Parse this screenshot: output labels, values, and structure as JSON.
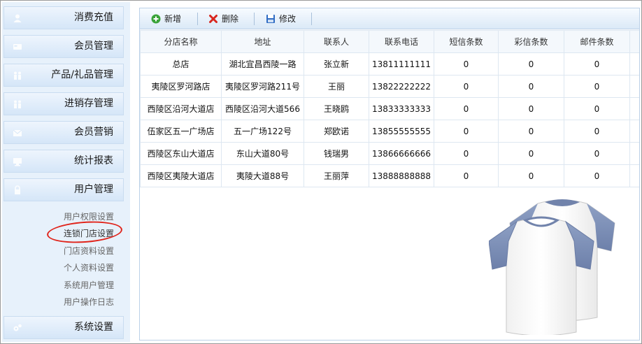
{
  "sidebar": {
    "menu": [
      {
        "label": "消费充值",
        "icon": "user-icon"
      },
      {
        "label": "会员管理",
        "icon": "card-icon"
      },
      {
        "label": "产品/礼品管理",
        "icon": "gift-icon"
      },
      {
        "label": "进销存管理",
        "icon": "box-icon"
      },
      {
        "label": "会员营销",
        "icon": "mail-icon"
      },
      {
        "label": "统计报表",
        "icon": "monitor-icon"
      },
      {
        "label": "用户管理",
        "icon": "lock-icon"
      },
      {
        "label": "系统设置",
        "icon": "gears-icon"
      }
    ],
    "submenu": [
      {
        "label": "用户权限设置"
      },
      {
        "label": "连锁门店设置"
      },
      {
        "label": "门店资料设置"
      },
      {
        "label": "个人资料设置"
      },
      {
        "label": "系统用户管理"
      },
      {
        "label": "用户操作日志"
      }
    ]
  },
  "toolbar": {
    "add_label": "新增",
    "delete_label": "删除",
    "edit_label": "修改"
  },
  "table": {
    "headers": [
      "分店名称",
      "地址",
      "联系人",
      "联系电话",
      "短信条数",
      "彩信条数",
      "邮件条数"
    ],
    "rows": [
      [
        "总店",
        "湖北宜昌西陵一路",
        "张立新",
        "13811111111",
        "0",
        "0",
        "0"
      ],
      [
        "夷陵区罗河路店",
        "夷陵区罗河路211号",
        "王丽",
        "13822222222",
        "0",
        "0",
        "0"
      ],
      [
        "西陵区沿河大道店",
        "西陵区沿河大道566",
        "王晓鸥",
        "13833333333",
        "0",
        "0",
        "0"
      ],
      [
        "伍家区五一广场店",
        "五一广场122号",
        "郑欧诺",
        "13855555555",
        "0",
        "0",
        "0"
      ],
      [
        "西陵区东山大道店",
        "东山大道80号",
        "钱瑞男",
        "13866666666",
        "0",
        "0",
        "0"
      ],
      [
        "西陵区夷陵大道店",
        "夷陵大道88号",
        "王丽萍",
        "13888888888",
        "0",
        "0",
        "0"
      ]
    ]
  },
  "colors": {
    "sidebar_bg": "#e7f1fb",
    "highlight_circle": "#e0241b",
    "add_icon": "#3aa33a",
    "delete_icon": "#d8261e",
    "edit_icon": "#2f6cc4"
  }
}
